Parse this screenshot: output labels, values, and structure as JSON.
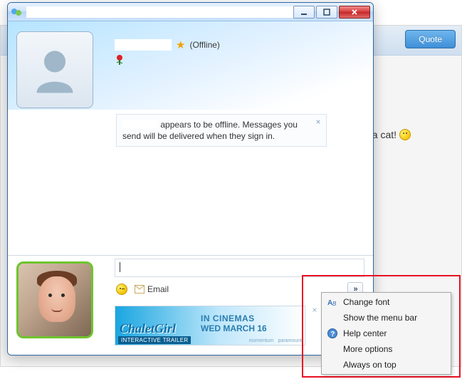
{
  "background": {
    "quote_button": "Quote",
    "partial_text": "kin a cat!"
  },
  "window": {
    "title": "",
    "controls": {
      "min": "minimize",
      "max": "maximize",
      "close": "close"
    },
    "contact": {
      "name": "",
      "status": "(Offline)"
    },
    "notice": {
      "text_after_name": "appears to be offline. Messages you send will be delivered when they sign in."
    },
    "compose": {
      "value": ""
    },
    "toolbar": {
      "email_label": "Email",
      "more_glyph": "»"
    },
    "ad": {
      "logo": "ChaletGirl",
      "line1": "IN CINEMAS",
      "line2": "WED MARCH 16",
      "tag": "INTERACTIVE TRAILER",
      "studio1": "momentum",
      "studio2": "paramount"
    }
  },
  "menu": {
    "items": [
      {
        "label": "Change font",
        "icon": "font"
      },
      {
        "label": "Show the menu bar",
        "icon": ""
      },
      {
        "label": "Help center",
        "icon": "help"
      },
      {
        "label": "More options",
        "icon": ""
      },
      {
        "label": "Always on top",
        "icon": ""
      }
    ]
  }
}
